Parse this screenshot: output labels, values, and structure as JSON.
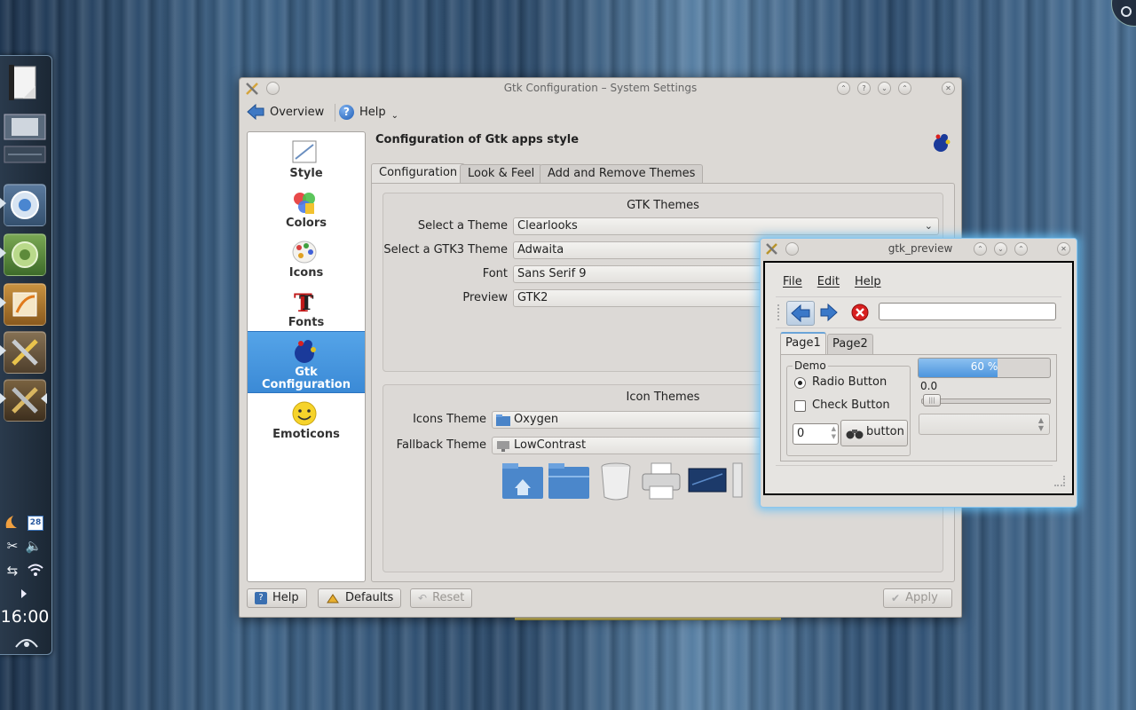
{
  "panel": {
    "clock": "16:00",
    "date_badge": "28",
    "launchers": [
      "notes-applet-icon",
      "window-list-icon",
      "chromium-icon",
      "kde-dragon-icon",
      "kpresenter-icon",
      "system-settings-icon",
      "xlauncher-icon"
    ]
  },
  "window": {
    "title": "Gtk Configuration – System Settings",
    "toolbar": {
      "overview_label": "Overview",
      "help_label": "Help"
    },
    "modules": [
      {
        "label": "Style"
      },
      {
        "label": "Colors"
      },
      {
        "label": "Icons"
      },
      {
        "label": "Fonts"
      },
      {
        "label_line1": "Gtk",
        "label_line2": "Configuration",
        "active": true
      },
      {
        "label": "Emoticons"
      }
    ],
    "heading": "Configuration of Gtk apps style",
    "tabs": [
      {
        "label": "Configuration",
        "active": true
      },
      {
        "label": "Look & Feel"
      },
      {
        "label": "Add and Remove Themes"
      }
    ],
    "gtk_themes": {
      "title": "GTK Themes",
      "theme_label": "Select a Theme",
      "theme_value": "Clearlooks",
      "gtk3_label": "Select a GTK3 Theme",
      "gtk3_value": "Adwaita",
      "font_label": "Font",
      "font_value": "Sans Serif 9",
      "preview_label": "Preview",
      "preview_value": "GTK2"
    },
    "icon_themes": {
      "title": "Icon Themes",
      "icons_label": "Icons Theme",
      "icons_value": "Oxygen",
      "fallback_label": "Fallback Theme",
      "fallback_value": "LowContrast"
    },
    "buttons": {
      "help": "Help",
      "defaults": "Defaults",
      "reset": "Reset",
      "apply": "Apply"
    },
    "colors": {
      "accent": "#3b8ad6",
      "window_bg": "#dcd9d5"
    }
  },
  "gtk_preview": {
    "title": "gtk_preview",
    "menu": [
      "File",
      "Edit",
      "Help"
    ],
    "url_value": "",
    "tabs": [
      {
        "label": "Page1",
        "active": true
      },
      {
        "label": "Page2"
      }
    ],
    "frame_label": "Demo",
    "radio_label": "Radio Button",
    "check_label": "Check Button",
    "spin_value": "0",
    "button_label": "button",
    "progress_text": "60 %",
    "progress_value": 0.6,
    "scale_value": "0.0"
  }
}
